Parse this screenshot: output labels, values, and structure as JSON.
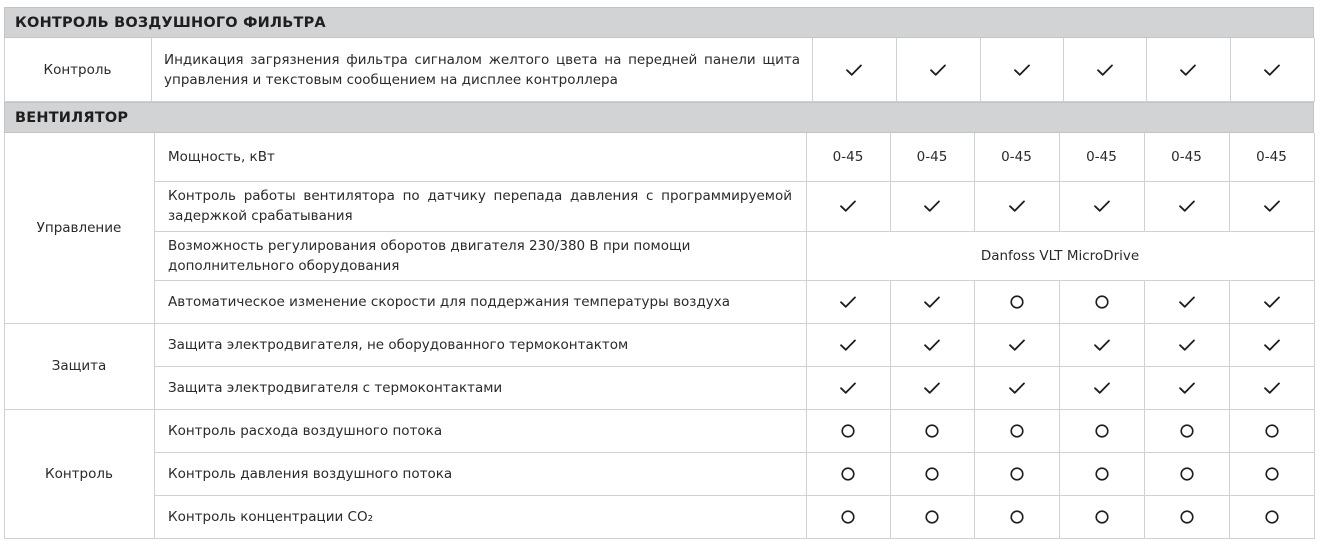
{
  "colors": {
    "header_bg": "#d2d3d5",
    "grid": "#d0d1d3",
    "text": "#2a2a2a",
    "mark": "#1e1e1e"
  },
  "legend": {
    "check": "check-icon",
    "circle": "circle-icon"
  },
  "sections": [
    {
      "title": "КОНТРОЛЬ ВОЗДУШНОГО ФИЛЬТРА",
      "groups": [
        {
          "label": "Контроль",
          "rows": [
            {
              "text": "Индикация загрязнения фильтра сигналом желтого цвета на передней панели щита управления и текстовым сообщением на дисплее контроллера",
              "cells": [
                "check",
                "check",
                "check",
                "check",
                "check",
                "check"
              ]
            }
          ]
        }
      ]
    },
    {
      "title": "ВЕНТИЛЯТОР",
      "groups": [
        {
          "label": "Управление",
          "rows": [
            {
              "text": "Мощность, кВт",
              "cells": [
                "0-45",
                "0-45",
                "0-45",
                "0-45",
                "0-45",
                "0-45"
              ]
            },
            {
              "text": "Контроль работы вентилятора по датчику перепада давления с программируемой задержкой срабатывания",
              "cells": [
                "check",
                "check",
                "check",
                "check",
                "check",
                "check"
              ]
            },
            {
              "text": "Возможность регулирования оборотов двигателя 230/380 В при помощи дополнительного оборудования",
              "merged": "Danfoss VLT MicroDrive"
            },
            {
              "text": "Автоматическое изменение скорости для поддержания температуры воздуха",
              "cells": [
                "check",
                "check",
                "circle",
                "circle",
                "check",
                "check"
              ]
            }
          ]
        },
        {
          "label": "Защита",
          "rows": [
            {
              "text": "Защита электродвигателя, не оборудованного термоконтактом",
              "cells": [
                "check",
                "check",
                "check",
                "check",
                "check",
                "check"
              ]
            },
            {
              "text": "Защита электродвигателя с термоконтактами",
              "cells": [
                "check",
                "check",
                "check",
                "check",
                "check",
                "check"
              ]
            }
          ]
        },
        {
          "label": "Контроль",
          "rows": [
            {
              "text": "Контроль расхода воздушного потока",
              "cells": [
                "circle",
                "circle",
                "circle",
                "circle",
                "circle",
                "circle"
              ]
            },
            {
              "text": "Контроль давления воздушного потока",
              "cells": [
                "circle",
                "circle",
                "circle",
                "circle",
                "circle",
                "circle"
              ]
            },
            {
              "text": "Контроль концентрации CO₂",
              "cells": [
                "circle",
                "circle",
                "circle",
                "circle",
                "circle",
                "circle"
              ]
            }
          ]
        }
      ]
    }
  ]
}
